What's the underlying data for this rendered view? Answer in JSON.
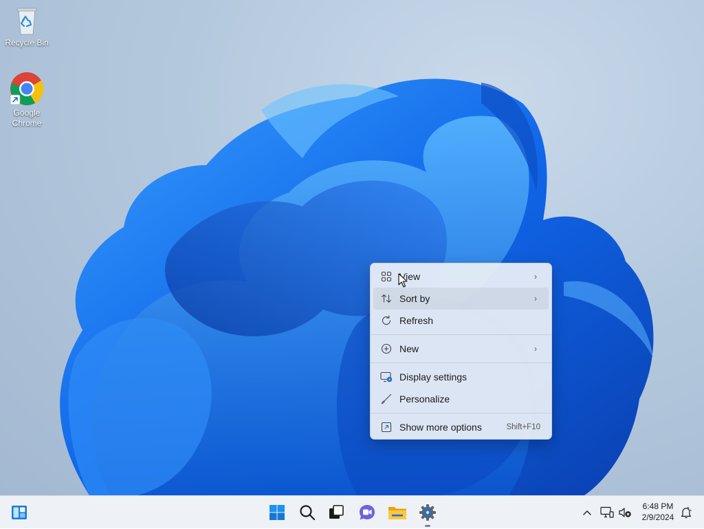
{
  "desktop": {
    "icons": [
      {
        "label": "Recycle Bin",
        "icon": "recycle-bin-icon"
      },
      {
        "label": "Google\nChrome",
        "icon": "chrome-icon"
      }
    ]
  },
  "context_menu": {
    "items": [
      {
        "label": "View",
        "icon": "grid-icon",
        "submenu": true
      },
      {
        "label": "Sort by",
        "icon": "sort-icon",
        "submenu": true
      },
      {
        "label": "Refresh",
        "icon": "refresh-icon"
      },
      {
        "label": "New",
        "icon": "plus-circle-icon",
        "submenu": true
      },
      {
        "label": "Display settings",
        "icon": "display-settings-icon"
      },
      {
        "label": "Personalize",
        "icon": "brush-icon"
      },
      {
        "label": "Show more options",
        "icon": "show-more-icon",
        "shortcut": "Shift+F10"
      }
    ],
    "submenu_arrow": "›"
  },
  "taskbar": {
    "apps": [
      "widgets-icon",
      "start-icon",
      "search-icon",
      "task-view-icon",
      "chat-icon",
      "file-explorer-icon",
      "settings-icon"
    ],
    "tray": [
      "chevron-up-icon",
      "network-icon",
      "volume-muted-icon",
      "notifications-icon"
    ],
    "clock": {
      "time": "6:48 PM",
      "date": "2/9/2024"
    }
  },
  "colors": {
    "accent": "#0a63d1",
    "menu_background": "#eef1f6",
    "taskbar_background": "#eef2f7"
  }
}
